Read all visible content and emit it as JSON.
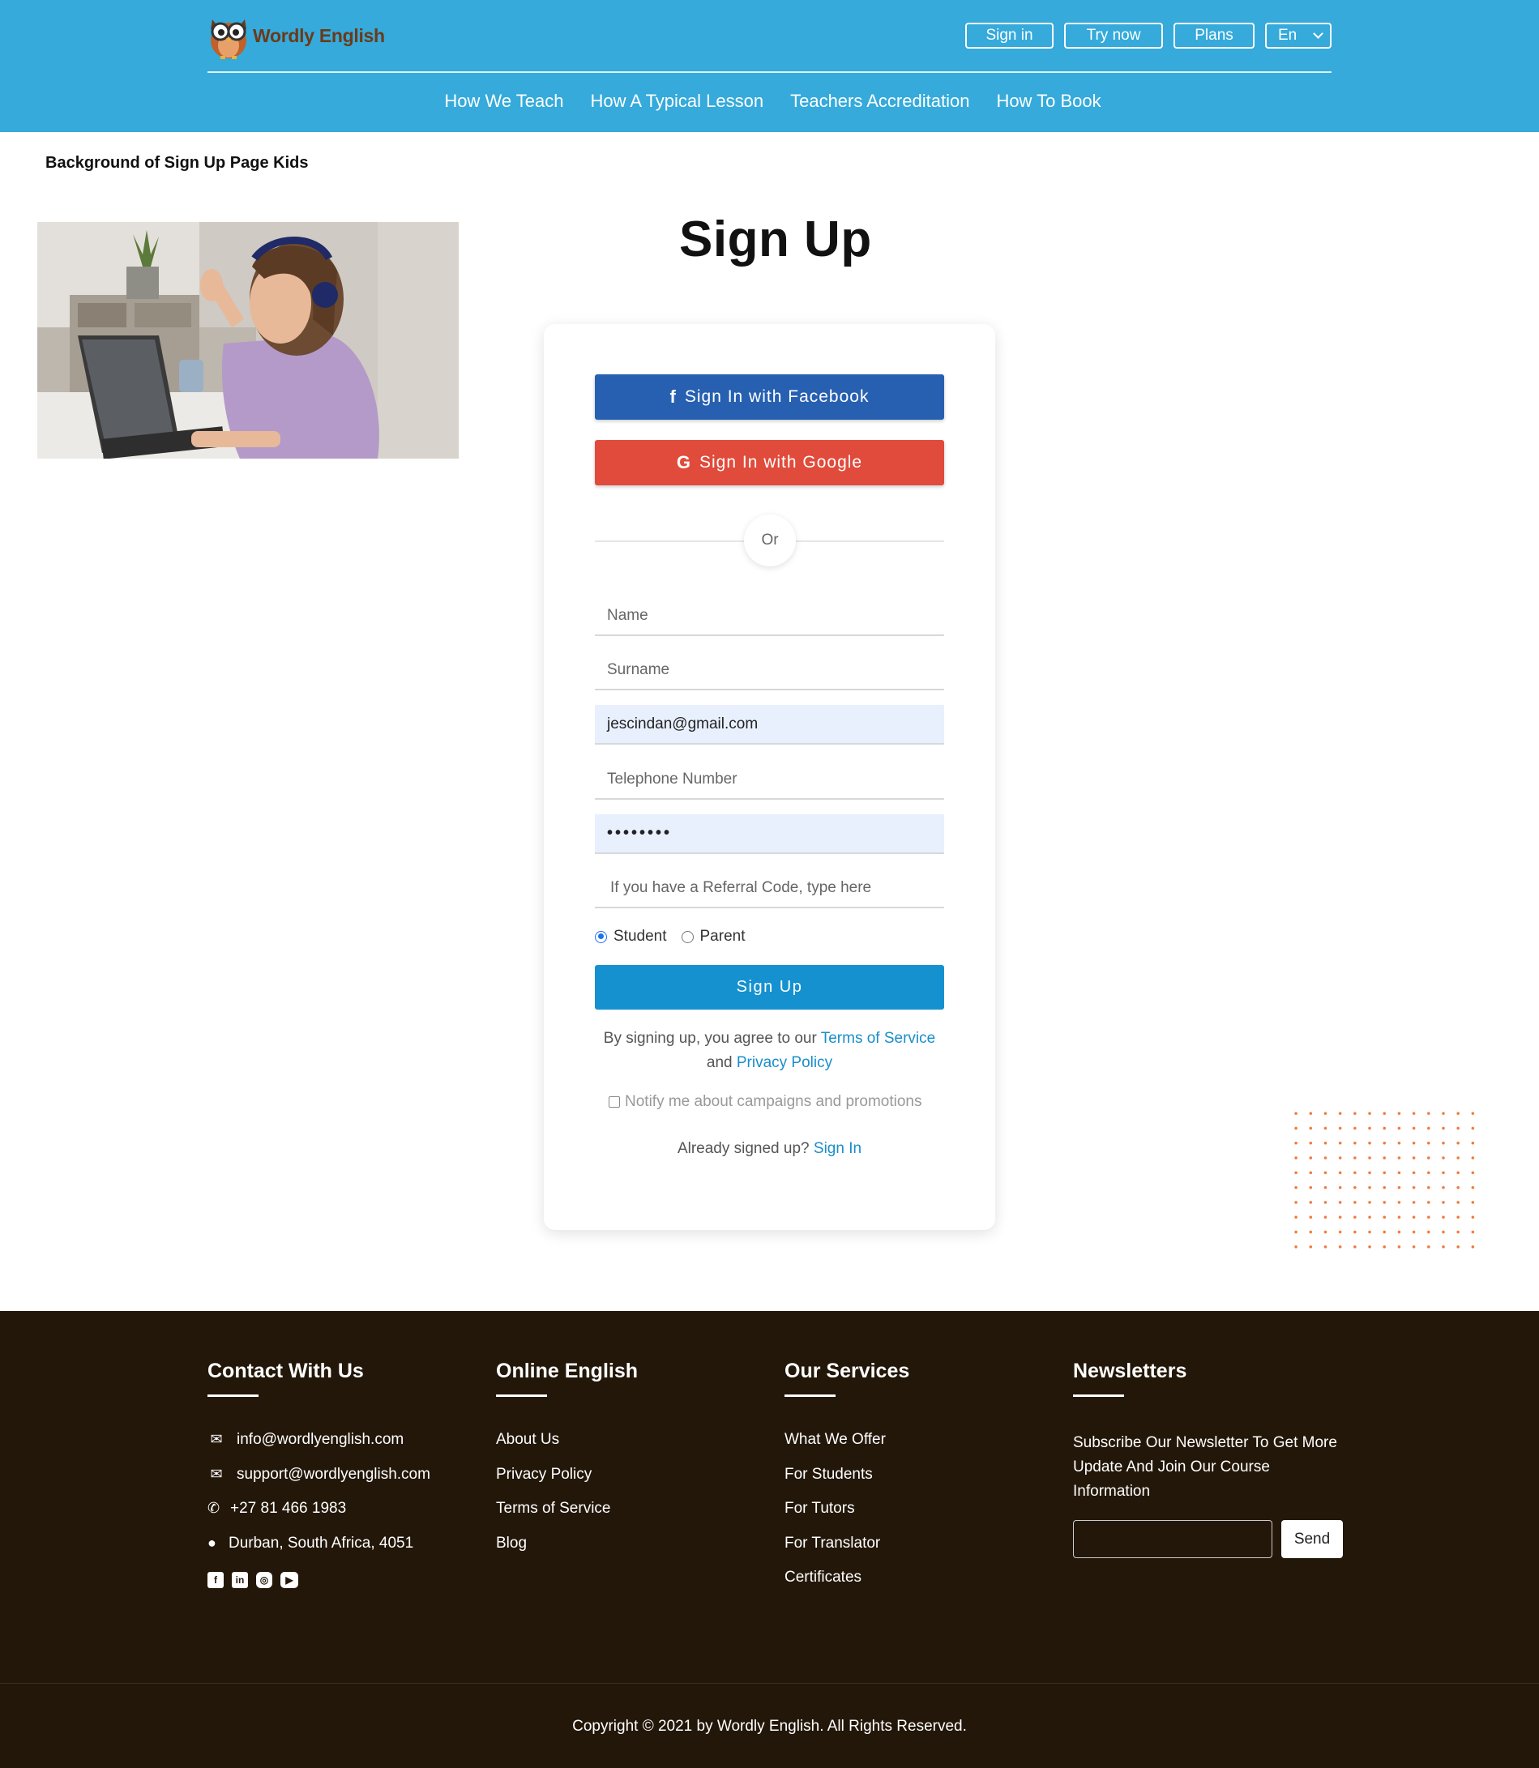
{
  "header": {
    "logo_text": "Wordly English",
    "buttons": {
      "sign_in": "Sign in",
      "try_now": "Try now",
      "plans": "Plans",
      "language": "En"
    },
    "nav": [
      "How We Teach",
      "How A Typical Lesson",
      "Teachers Accreditation",
      "How To Book"
    ]
  },
  "main": {
    "background_caption": "Background of Sign Up Page Kids",
    "title": "Sign Up"
  },
  "form": {
    "facebook_label": "Sign In with Facebook",
    "google_label": "Sign In with Google",
    "or_label": "Or",
    "name_placeholder": "Name",
    "surname_placeholder": "Surname",
    "email_value": "jescindan@gmail.com",
    "telephone_placeholder": "Telephone Number",
    "password_value": "••••••••",
    "referral_placeholder": "If you have a Referral Code, type here",
    "role_options": [
      "Student",
      "Parent"
    ],
    "selected_role": "Student",
    "signup_label": "Sign Up",
    "agree_prefix": "By signing up, you agree to our",
    "terms_link": "Terms of Service",
    "agree_and": "and",
    "privacy_link": "Privacy Policy",
    "notify_label": "Notify me about campaigns and promotions",
    "already_text": "Already signed up?",
    "sign_in_link": "Sign In"
  },
  "footer": {
    "contact": {
      "title": "Contact With Us",
      "email1": "info@wordlyenglish.com",
      "email2": "support@wordlyenglish.com",
      "phone": "+27 81 466 1983",
      "address": "Durban, South Africa, 4051"
    },
    "online_english": {
      "title": "Online English",
      "links": [
        "About Us",
        "Privacy Policy",
        "Terms of Service",
        "Blog"
      ]
    },
    "services": {
      "title": "Our Services",
      "links": [
        "What We Offer",
        "For Students",
        "For Tutors",
        "For Translator",
        "Certificates"
      ]
    },
    "newsletter": {
      "title": "Newsletters",
      "text": "Subscribe Our Newsletter To Get More Update And Join Our Course Information",
      "send_label": "Send"
    },
    "copyright": "Copyright © 2021 by Wordly English. All Rights Reserved."
  },
  "colors": {
    "header_bg": "#35aadb",
    "facebook": "#2760b1",
    "google": "#e04b3b",
    "signup": "#1591cf",
    "footer_bg": "#231709",
    "accent_dots": "#f07a3a"
  }
}
